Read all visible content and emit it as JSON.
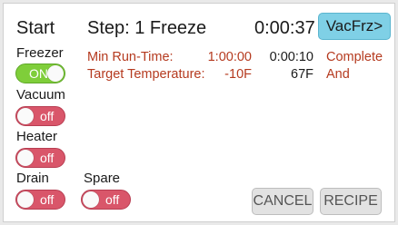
{
  "header": {
    "state_label": "Start",
    "step_label": "Step: 1 Freeze",
    "elapsed": "0:00:37",
    "next_button": "VacFrz>"
  },
  "step_table": {
    "rows": [
      {
        "label": "Min Run-Time:",
        "target": "1:00:00",
        "current": "0:00:10",
        "status": "Complete"
      },
      {
        "label": "Target Temperature:",
        "target": "-10F",
        "current": "67F",
        "status": "And"
      }
    ]
  },
  "controls": {
    "freezer": {
      "label": "Freezer",
      "state": "ON"
    },
    "vacuum": {
      "label": "Vacuum",
      "state": "off"
    },
    "heater": {
      "label": "Heater",
      "state": "off"
    },
    "drain": {
      "label": "Drain",
      "state": "off"
    },
    "spare": {
      "label": "Spare",
      "state": "off"
    }
  },
  "footer": {
    "cancel": "CANCEL",
    "recipe": "RECIPE"
  },
  "colors": {
    "accent_button": "#7fd0e6",
    "toggle_on": "#7fce3a",
    "toggle_off": "#d9566a",
    "step_text": "#b53a1f"
  }
}
